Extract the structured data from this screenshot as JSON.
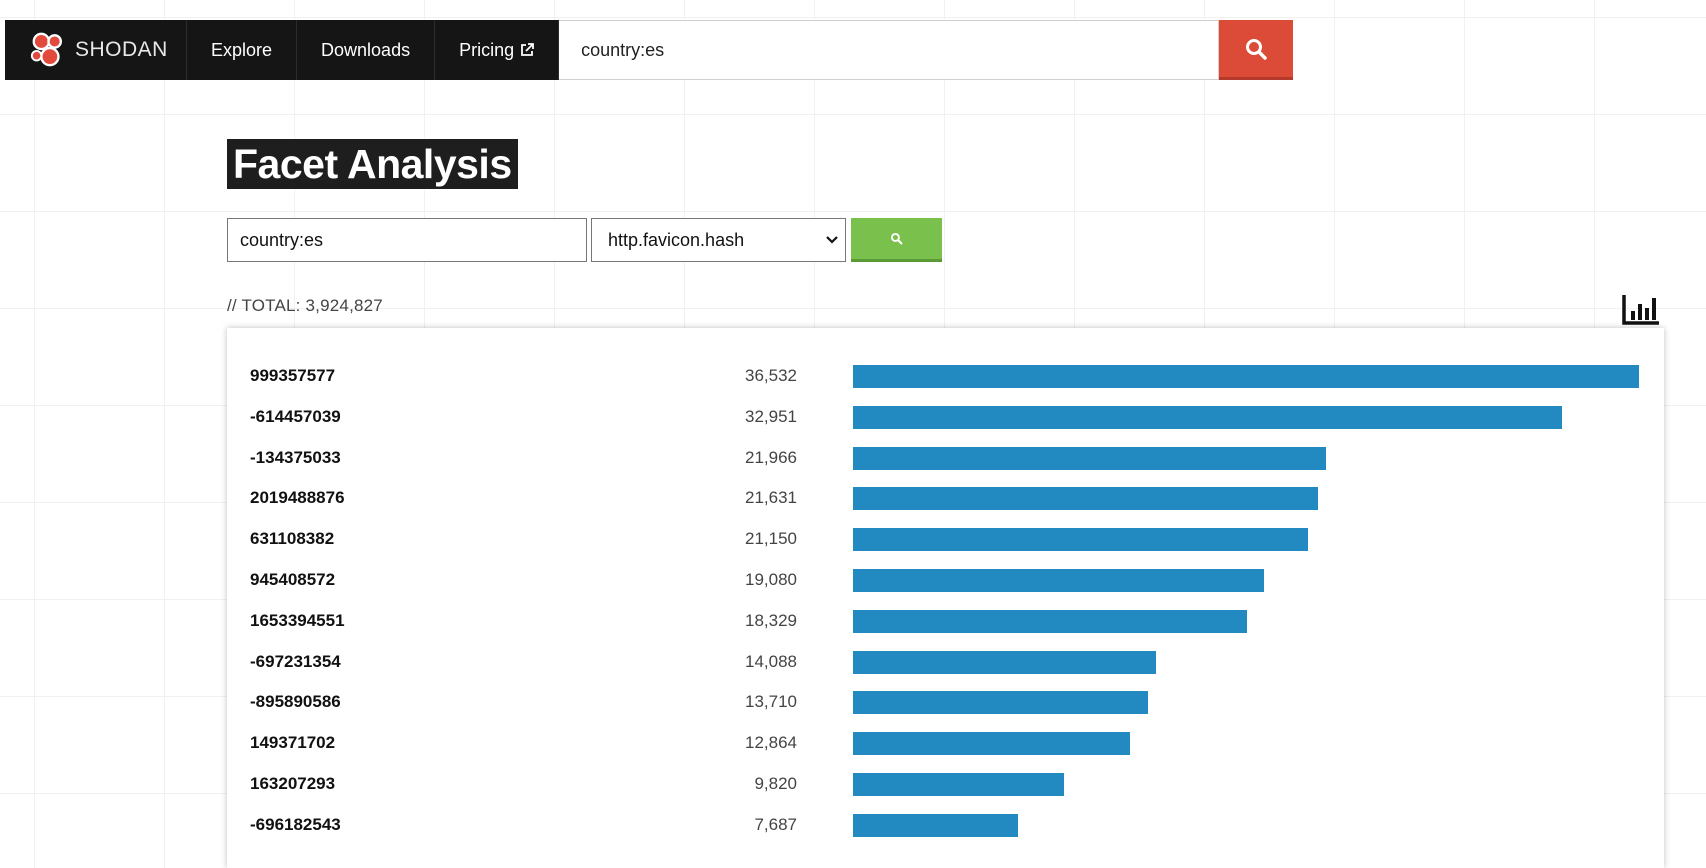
{
  "nav": {
    "brand": "SHODAN",
    "links": [
      {
        "label": "Explore"
      },
      {
        "label": "Downloads"
      },
      {
        "label": "Pricing"
      }
    ],
    "search_value": "country:es"
  },
  "page": {
    "title": "Facet Analysis",
    "query_value": "country:es",
    "facet_selected": "http.favicon.hash",
    "total_label": "// TOTAL: 3,924,827"
  },
  "colors": {
    "bar": "#2289c1",
    "search_button": "#dc4a38",
    "facet_button": "#79c04d"
  },
  "chart_data": {
    "type": "bar",
    "orientation": "horizontal",
    "max_value": 36532,
    "categories": [
      "999357577",
      "-614457039",
      "-134375033",
      "2019488876",
      "631108382",
      "945408572",
      "1653394551",
      "-697231354",
      "-895890586",
      "149371702",
      "163207293",
      "-696182543"
    ],
    "values": [
      36532,
      32951,
      21966,
      21631,
      21150,
      19080,
      18329,
      14088,
      13710,
      12864,
      9820,
      7687
    ],
    "value_labels": [
      "36,532",
      "32,951",
      "21,966",
      "21,631",
      "21,150",
      "19,080",
      "18,329",
      "14,088",
      "13,710",
      "12,864",
      "9,820",
      "7,687"
    ]
  }
}
